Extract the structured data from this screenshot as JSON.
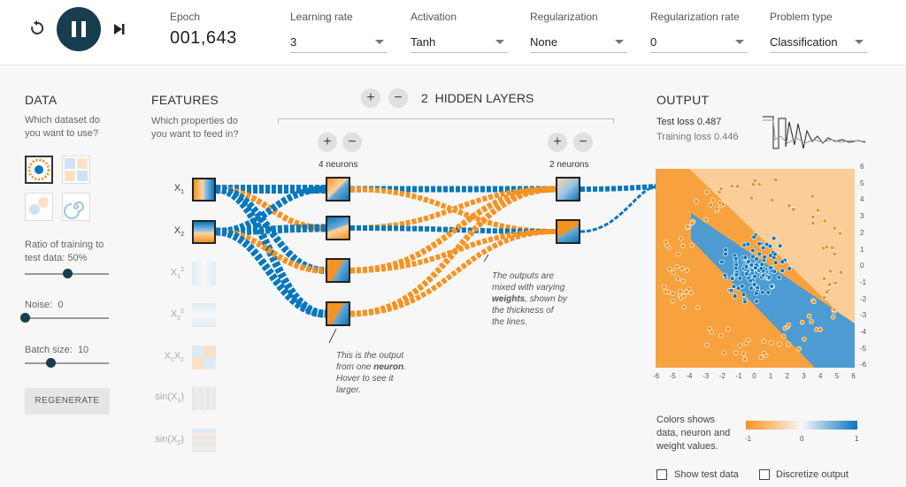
{
  "toolbar": {
    "epoch_label": "Epoch",
    "epoch_value": "001,643",
    "learning_rate_label": "Learning rate",
    "learning_rate_value": "3",
    "activation_label": "Activation",
    "activation_value": "Tanh",
    "regularization_label": "Regularization",
    "regularization_value": "None",
    "reg_rate_label": "Regularization rate",
    "reg_rate_value": "0",
    "problem_type_label": "Problem type",
    "problem_type_value": "Classification"
  },
  "data_panel": {
    "title": "DATA",
    "question": "Which dataset do you want to use?",
    "ratio_label": "Ratio of training to test data:",
    "ratio_value": "50%",
    "ratio_fraction": 0.5,
    "noise_label": "Noise:",
    "noise_value": "0",
    "noise_fraction": 0,
    "batch_label": "Batch size:",
    "batch_value": "10",
    "batch_fraction": 0.3,
    "regenerate_label": "REGENERATE"
  },
  "features": {
    "title": "FEATURES",
    "question": "Which properties do you want to feed in?",
    "items": [
      {
        "base": "X",
        "sub": "1",
        "sup": ""
      },
      {
        "base": "X",
        "sub": "2",
        "sup": ""
      },
      {
        "base": "X",
        "sub": "1",
        "sup": "2"
      },
      {
        "base": "X",
        "sub": "2",
        "sup": "2"
      },
      {
        "base": "X",
        "sub": "1",
        "sup": "",
        "base2": "X",
        "sub2": "2"
      },
      {
        "base": "sin(X",
        "sub": "1",
        "sup": "",
        "tail": ")"
      },
      {
        "base": "sin(X",
        "sub": "2",
        "sup": "",
        "tail": ")"
      }
    ]
  },
  "network": {
    "hidden_count": "2",
    "hidden_label": "HIDDEN LAYERS",
    "layer1_label": "4 neurons",
    "layer2_label": "2 neurons",
    "note1_a": "This is the output from one",
    "note1_b": "neuron",
    "note1_c": ". Hover to see it larger.",
    "note2_a": "The outputs are mixed with varying",
    "note2_b": "weights",
    "note2_c": ", shown by the thickness of the lines."
  },
  "output": {
    "title": "OUTPUT",
    "test_loss_label": "Test loss",
    "test_loss_value": "0.487",
    "train_loss_label": "Training loss",
    "train_loss_value": "0.446",
    "x_ticks": [
      "-6",
      "-5",
      "-4",
      "-3",
      "-2",
      "-1",
      "0",
      "1",
      "2",
      "3",
      "4",
      "5",
      "6"
    ],
    "y_ticks": [
      "6",
      "5",
      "4",
      "3",
      "2",
      "1",
      "0",
      "-1",
      "-2",
      "-3",
      "-4",
      "-5",
      "-6"
    ],
    "legend_text": "Colors shows data, neuron and weight values.",
    "legend_ticks": [
      "-1",
      "0",
      "1"
    ],
    "show_test_label": "Show test data",
    "discretize_label": "Discretize output"
  },
  "colors": {
    "orange": "#f59322",
    "blue": "#0877bd",
    "dark": "#183d4e"
  }
}
